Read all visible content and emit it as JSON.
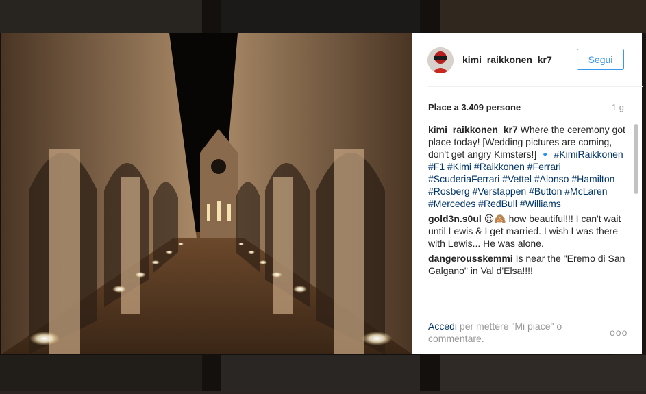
{
  "post": {
    "username": "kimi_raikkonen_kr7",
    "follow_label": "Segui",
    "likes_text": "Place a 3.409 persone",
    "time_ago": "1 g"
  },
  "caption": {
    "author": "kimi_raikkonen_kr7",
    "text_1": " Where the ceremony got place today! [Wedding pictures are coming, don't get angry Kimsters!] ",
    "diamond": "🔹",
    "hashtags": [
      "#KimiRaikkonen",
      "#F1",
      "#Kimi",
      "#Raikkonen",
      "#Ferrari",
      "#ScuderiaFerrari",
      "#Vettel",
      "#Alonso",
      "#Hamilton",
      "#Rosberg",
      "#Verstappen",
      "#Button",
      "#McLaren",
      "#Mercedes",
      "#RedBull",
      "#Williams"
    ]
  },
  "comments": [
    {
      "author": "gold3n.s0ul",
      "emoji": "😍🙈",
      "text": " how beautiful!!! I can't wait until Lewis & I get married. I wish I was there with Lewis... He was alone."
    },
    {
      "author": "dangerousskemmi",
      "text": " Is near the \"Eremo di San Galgano\" in Val d'Elsa!!!!"
    }
  ],
  "footer": {
    "login_link": "Accedi",
    "login_rest": " per mettere \"Mi piace\" o commentare.",
    "more": "ooo"
  },
  "colors": {
    "link": "#003569",
    "accent": "#3897f0",
    "muted": "#999999"
  }
}
